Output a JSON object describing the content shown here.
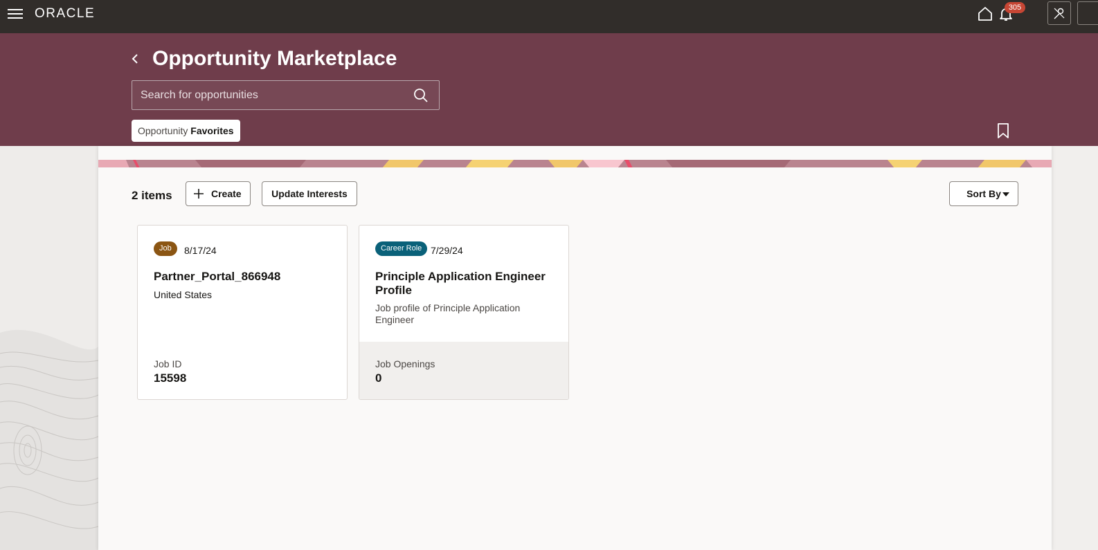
{
  "topbar": {
    "brand": "ORACLE",
    "notifications_count": "305"
  },
  "header": {
    "title": "Opportunity Marketplace",
    "search_placeholder": "Search for opportunities",
    "chip_prefix": "Opportunity",
    "chip_label": "Favorites"
  },
  "toolbar": {
    "items_count": "2 items",
    "create_label": "Create",
    "update_label": "Update Interests",
    "sort_label": "Sort By"
  },
  "cards": [
    {
      "tag": "Job",
      "date": "8/17/24",
      "title": "Partner_Portal_866948",
      "subtitle": "United States",
      "footer_label": "Job ID",
      "footer_value": "15598"
    },
    {
      "tag": "Career Role",
      "date": "7/29/24",
      "title": "Principle Application Engineer Profile",
      "subtitle": "Job profile of Principle Application Engineer",
      "footer_label": "Job Openings",
      "footer_value": "0"
    }
  ],
  "colors": {
    "topbar": "#312d2a",
    "header": "#6f3d4b",
    "badge": "#c74634",
    "tag_job": "#8b5513",
    "tag_role": "#0a6179"
  },
  "icons": [
    "hamburger-icon",
    "home-icon",
    "bell-icon",
    "user-icon",
    "back-chevron-icon",
    "search-icon",
    "bookmark-icon",
    "plus-icon",
    "caret-down-icon"
  ]
}
